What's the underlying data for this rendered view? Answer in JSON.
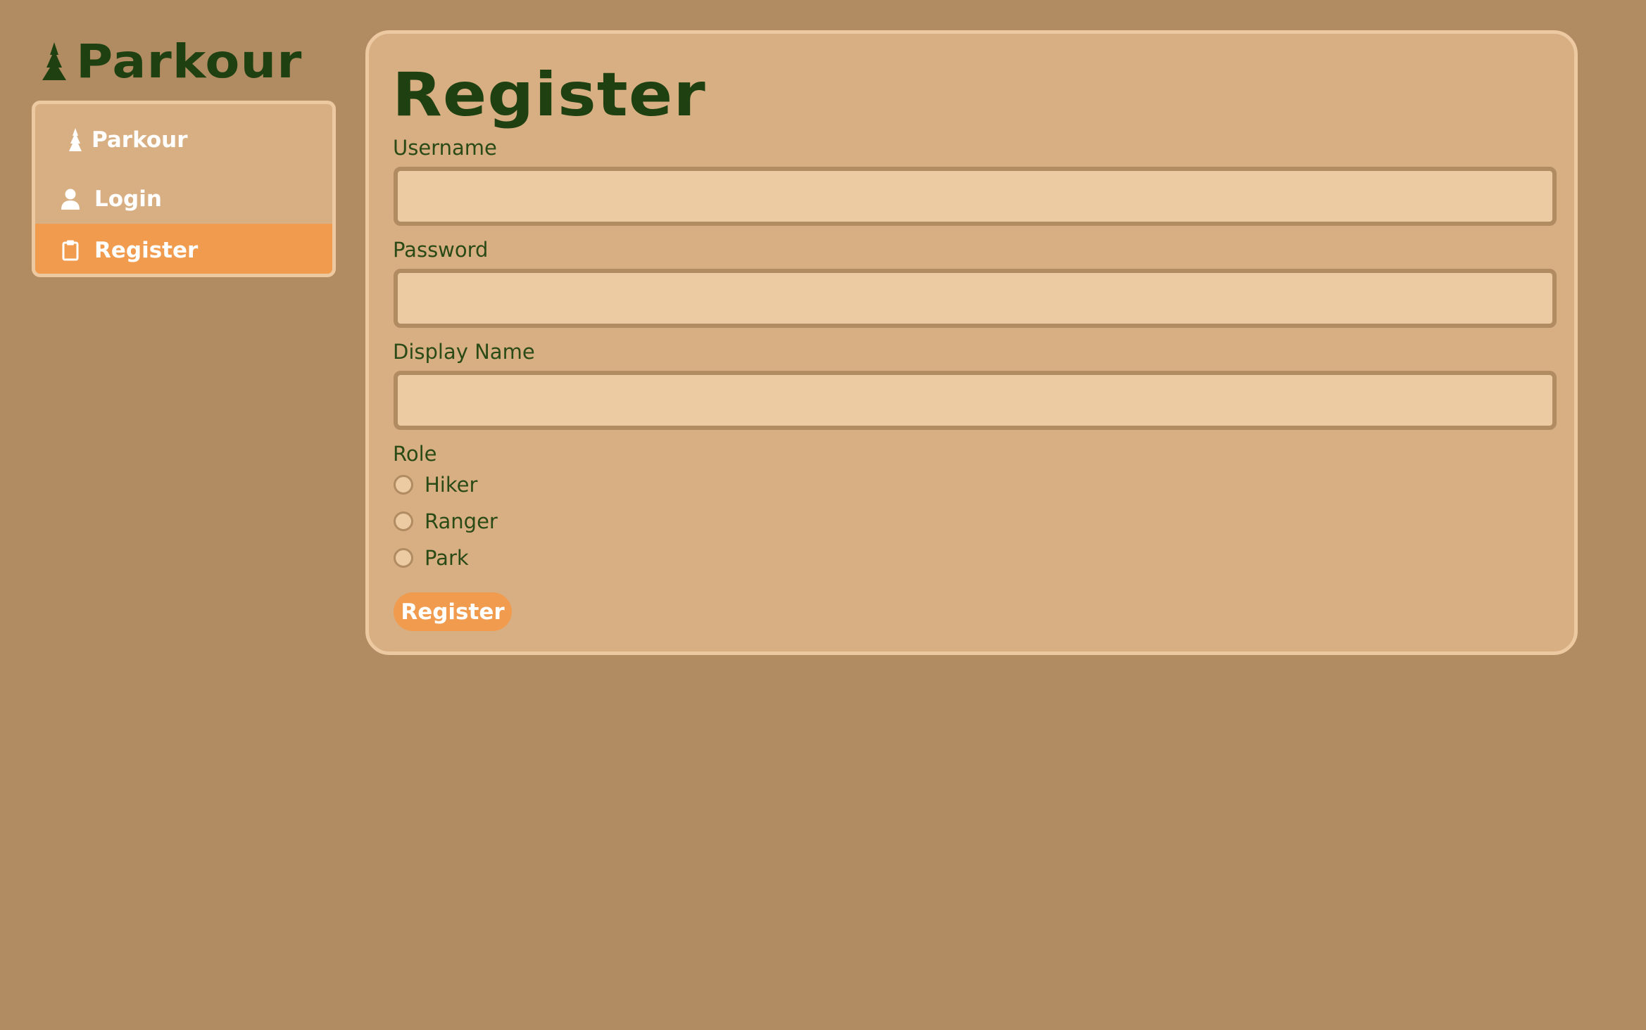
{
  "brand": {
    "title": "Parkour",
    "icon": "tree-icon"
  },
  "sidebar": {
    "items": [
      {
        "label": "Parkour",
        "icon": "tree-icon",
        "active": false
      },
      {
        "label": "Login",
        "icon": "user-icon",
        "active": false
      },
      {
        "label": "Register",
        "icon": "clipboard-icon",
        "active": true
      }
    ]
  },
  "form": {
    "title": "Register",
    "fields": [
      {
        "label": "Username",
        "value": "",
        "placeholder": ""
      },
      {
        "label": "Password",
        "value": "",
        "placeholder": ""
      },
      {
        "label": "Display Name",
        "value": "",
        "placeholder": ""
      }
    ],
    "role": {
      "label": "Role",
      "options": [
        "Hiker",
        "Ranger",
        "Park"
      ],
      "selected": null
    },
    "submit_label": "Register"
  },
  "colors": {
    "background": "#b18b61",
    "panel": "#d8af83",
    "panel_border": "#ecc9a1",
    "input_fill": "#eccaa2",
    "accent": "#f09b4d",
    "heading": "#1f4112",
    "text_on_accent": "#ffffff"
  }
}
